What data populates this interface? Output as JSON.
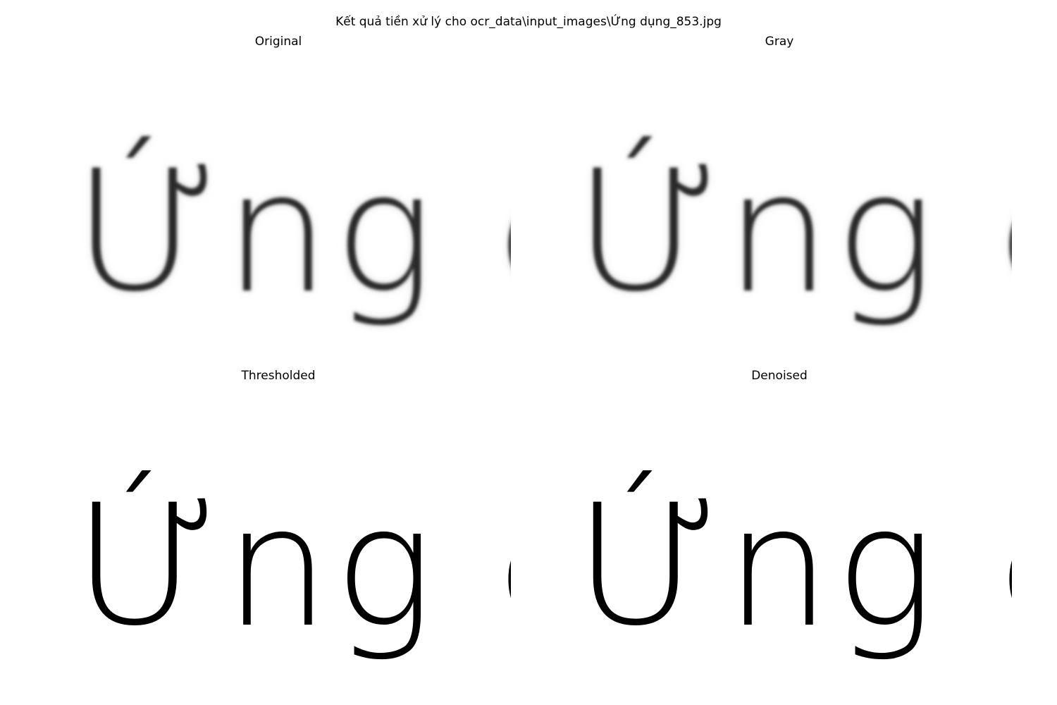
{
  "figure": {
    "suptitle": "Kết quả tiền xử lý cho ocr_data\\input_images\\Ứng dụng_853.jpg"
  },
  "panels": [
    {
      "title": "Original",
      "image_text": "Ứng dụng",
      "style": "blurred"
    },
    {
      "title": "Gray",
      "image_text": "Ứng dụng",
      "style": "blurred-gray"
    },
    {
      "title": "Thresholded",
      "image_text": "Ứng dụng",
      "style": "binary"
    },
    {
      "title": "Denoised",
      "image_text": "Ứng dụng",
      "style": "binary"
    }
  ],
  "colors": {
    "background": "#ffffff",
    "ink_blurred": "#2a2a2a",
    "ink_binary": "#000000"
  }
}
